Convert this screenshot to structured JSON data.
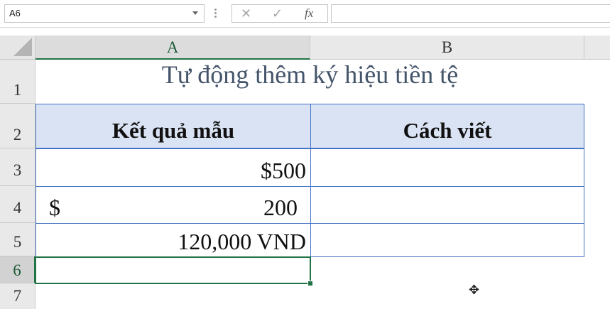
{
  "formula_bar": {
    "name_box": "A6",
    "cancel_icon": "✕",
    "enter_icon": "✓",
    "fx_label": "fx",
    "formula_value": ""
  },
  "columns": [
    "A",
    "B"
  ],
  "rows": [
    "1",
    "2",
    "3",
    "4",
    "5",
    "6",
    "7"
  ],
  "sheet": {
    "title": "Tự động thêm ký hiệu tiền tệ",
    "header_a": "Kết quả mẫu",
    "header_b": "Cách viết",
    "r3_a": "$500",
    "r4_a_symbol": "$",
    "r4_a_value": "200",
    "r5_a": "120,000 VND"
  },
  "colors": {
    "accent_green": "#217346",
    "header_fill": "#dae3f3",
    "table_border": "#4472c4",
    "title_text": "#44546a"
  }
}
